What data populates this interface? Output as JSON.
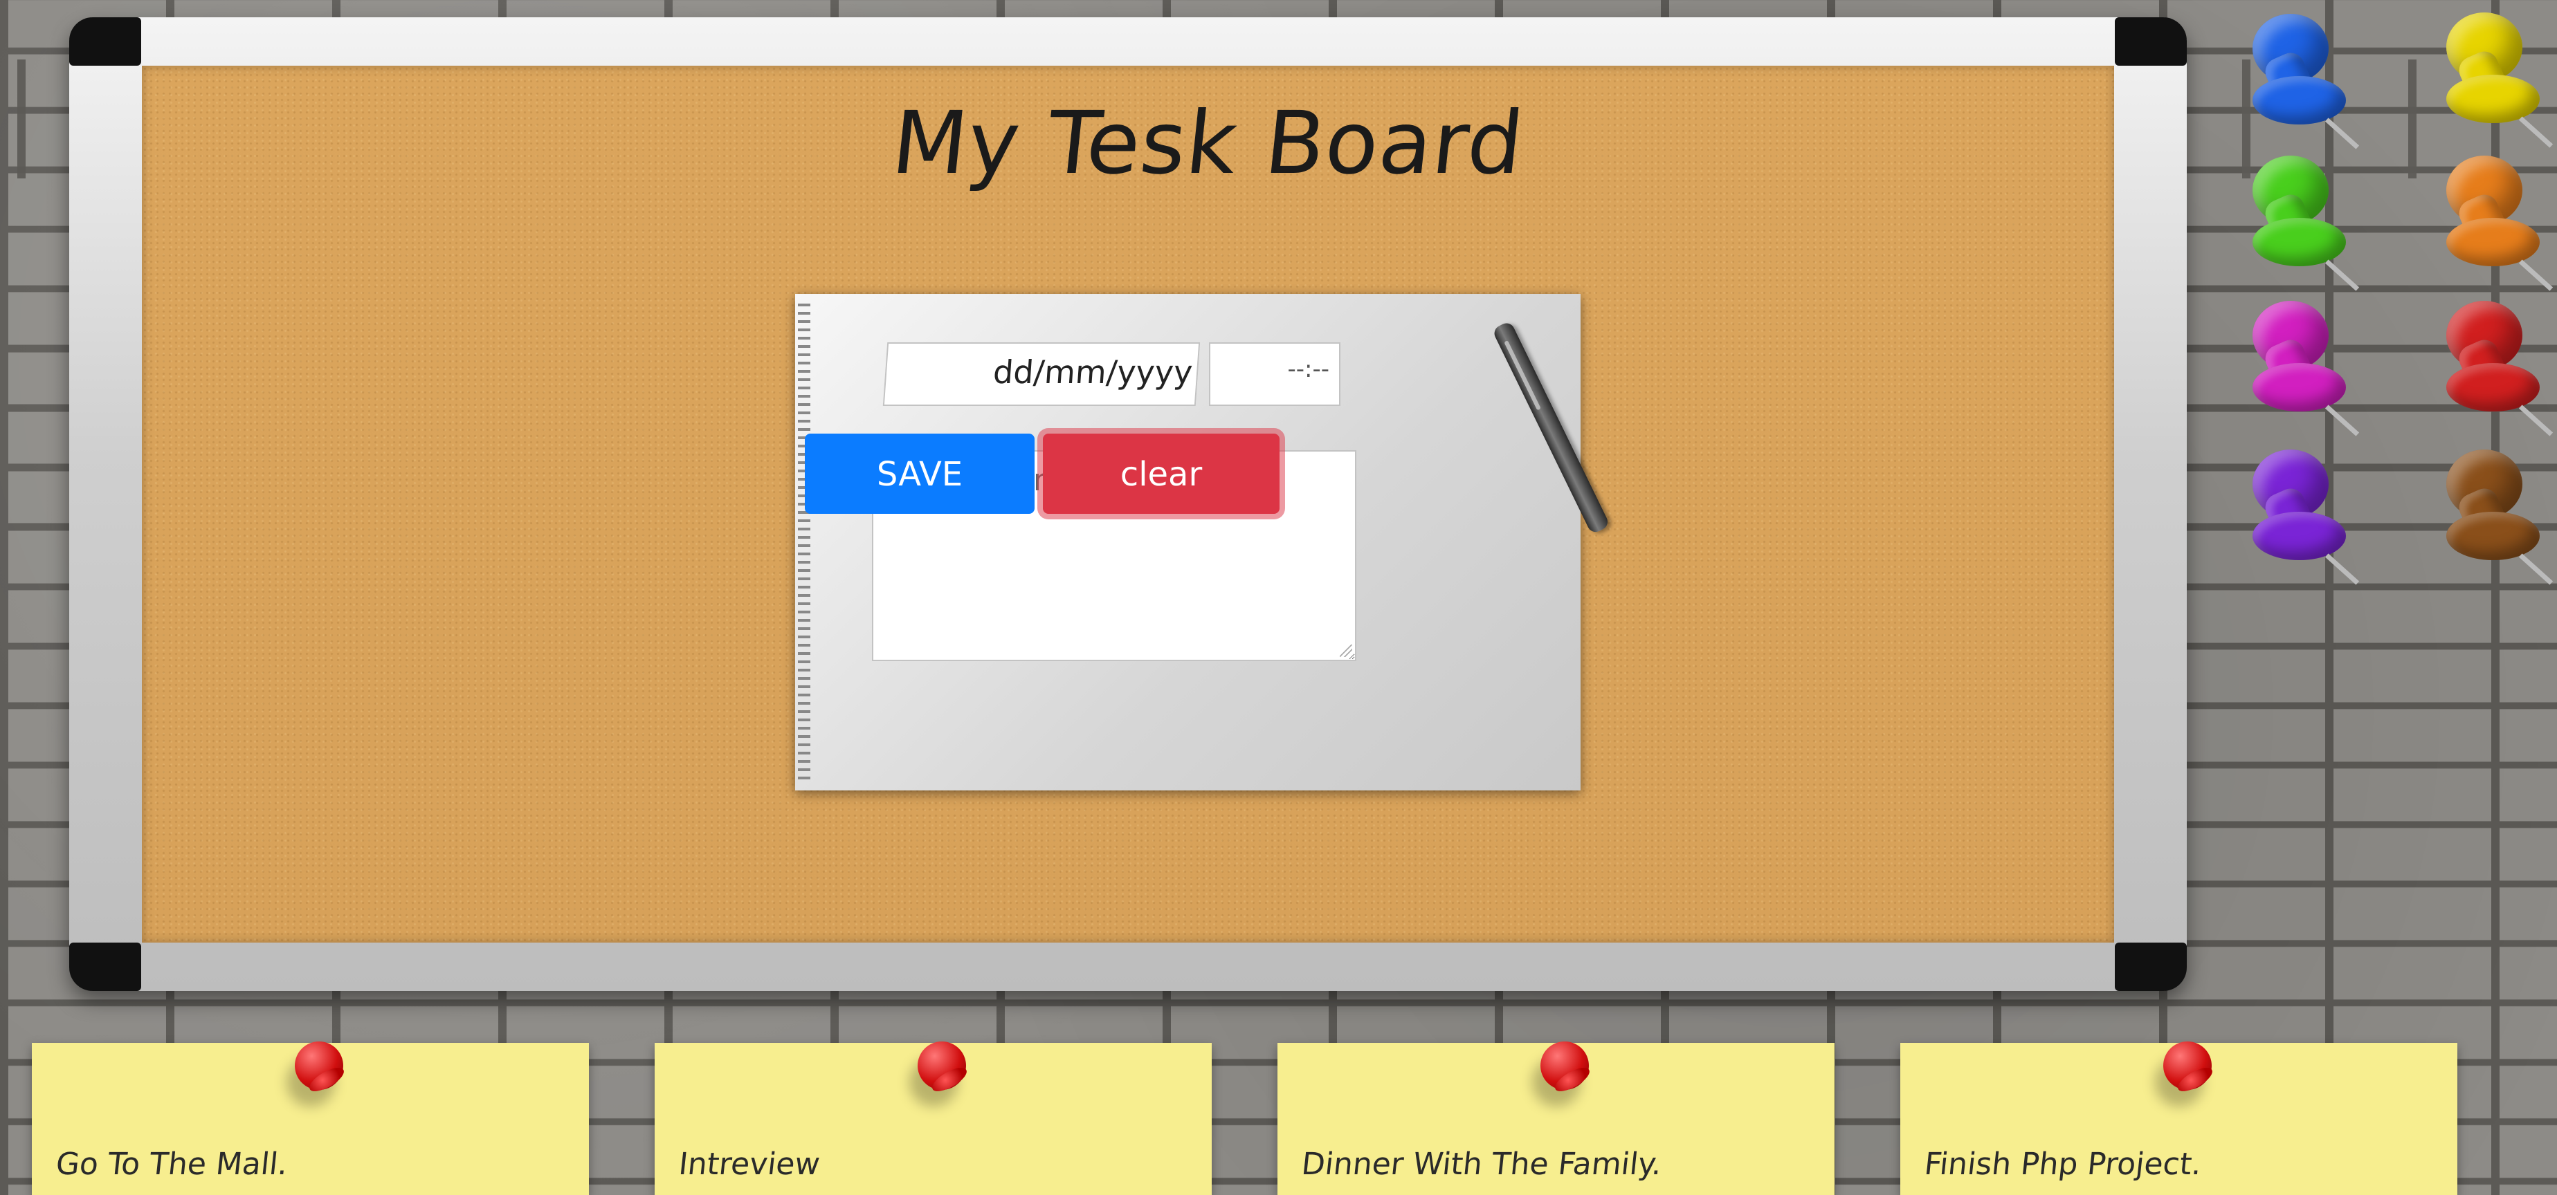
{
  "board": {
    "title": "My Tesk Board"
  },
  "form": {
    "date_placeholder": "dd/mm/yyyy",
    "time_placeholder": "--:--",
    "mission_placeholder": "my mission",
    "save_label": "SAVE",
    "clear_label": "clear"
  },
  "notes": [
    {
      "text": "Go To The Mall."
    },
    {
      "text": "Intreview"
    },
    {
      "text": "Dinner With The Family."
    },
    {
      "text": "Finish Php Project."
    }
  ],
  "pin_colors": {
    "blue": "#1f63e6",
    "yellow": "#e7d400",
    "green": "#49cf1d",
    "orange": "#e67d1b",
    "magenta": "#d21fc0",
    "red": "#d11f1f",
    "purple": "#7a24d6",
    "brown": "#8a4f1a"
  },
  "colors": {
    "save_button": "#0b7cff",
    "clear_button": "#dc3545",
    "note": "#f7ee8f",
    "cork": "#d7a159"
  }
}
